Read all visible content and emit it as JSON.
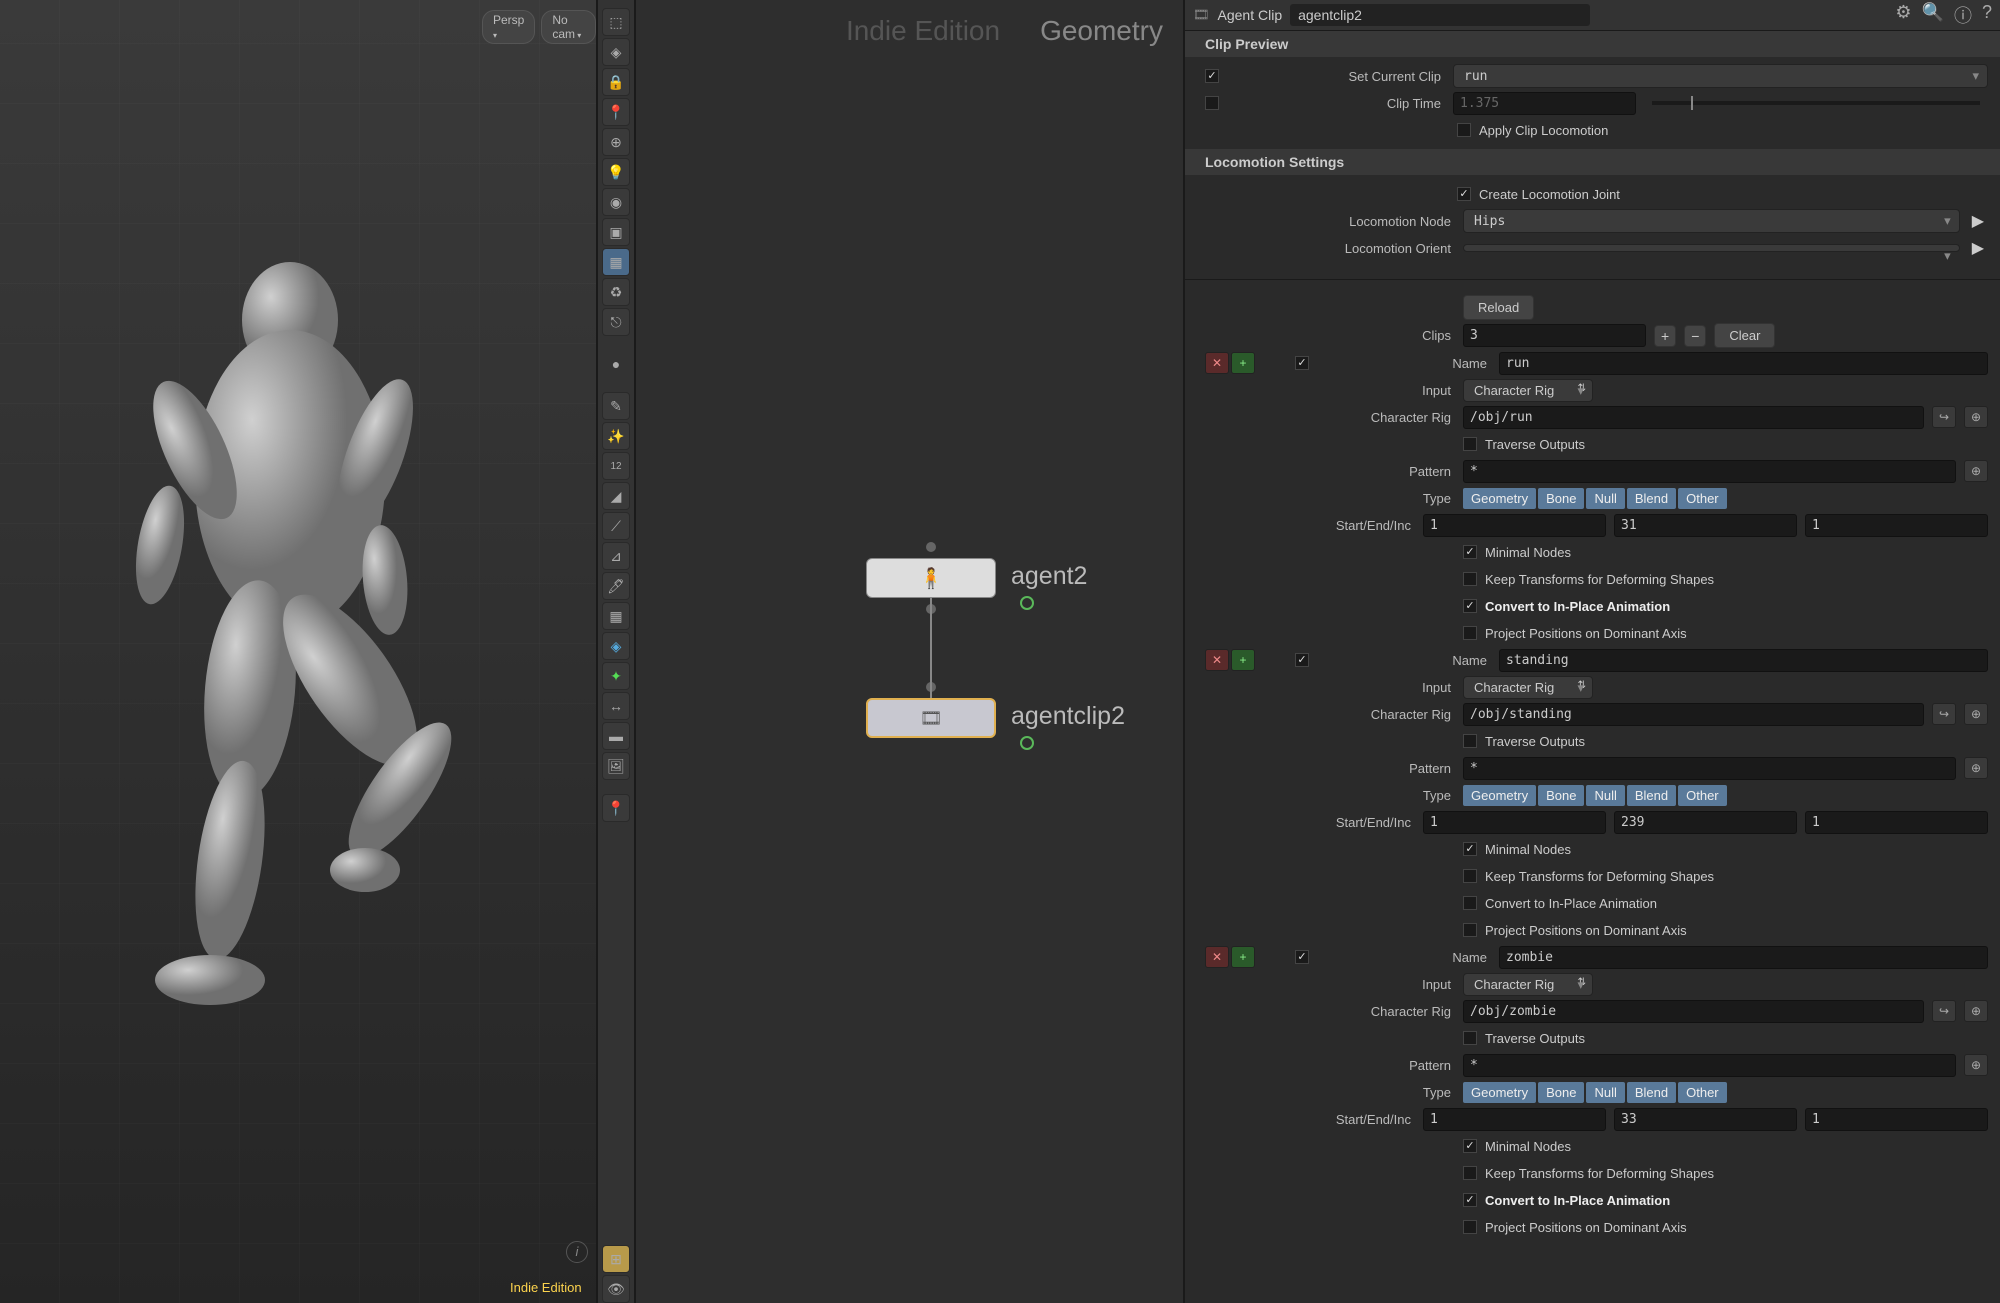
{
  "viewport": {
    "persp_btn": "Persp",
    "cam_btn": "No cam",
    "edition": "Indie Edition"
  },
  "network": {
    "title1": "Indie Edition",
    "title2": "Geometry",
    "nodes": {
      "agent2": "agent2",
      "agentclip2": "agentclip2"
    }
  },
  "params": {
    "node_type": "Agent Clip",
    "node_name": "agentclip2",
    "clip_preview": {
      "header": "Clip Preview",
      "set_clip_label": "Set Current Clip",
      "set_clip_value": "run",
      "clip_time_label": "Clip Time",
      "clip_time_value": "1.375",
      "apply_loco": "Apply Clip Locomotion"
    },
    "loco": {
      "header": "Locomotion Settings",
      "create_joint": "Create Locomotion Joint",
      "node_label": "Locomotion Node",
      "node_value": "Hips",
      "orient_label": "Locomotion Orient",
      "orient_value": ""
    },
    "reload": "Reload",
    "clips_label": "Clips",
    "clips_count": "3",
    "clear": "Clear",
    "clip_labels": {
      "name": "Name",
      "input": "Input",
      "char_rig": "Character Rig",
      "traverse": "Traverse Outputs",
      "pattern": "Pattern",
      "type": "Type",
      "sei": "Start/End/Inc",
      "minimal": "Minimal Nodes",
      "keep_xform": "Keep Transforms for Deforming Shapes",
      "inplace": "Convert to In-Place Animation",
      "project": "Project Positions on Dominant Axis",
      "input_val": "Character Rig"
    },
    "types": [
      "Geometry",
      "Bone",
      "Null",
      "Blend",
      "Other"
    ],
    "clips": [
      {
        "name": "run",
        "rig": "/obj/run",
        "pattern": "*",
        "start": "1",
        "end": "31",
        "inc": "1",
        "minimal": true,
        "keep": false,
        "inplace": true,
        "project": false
      },
      {
        "name": "standing",
        "rig": "/obj/standing",
        "pattern": "*",
        "start": "1",
        "end": "239",
        "inc": "1",
        "minimal": true,
        "keep": false,
        "inplace": false,
        "project": false
      },
      {
        "name": "zombie",
        "rig": "/obj/zombie",
        "pattern": "*",
        "start": "1",
        "end": "33",
        "inc": "1",
        "minimal": true,
        "keep": false,
        "inplace": true,
        "project": false
      }
    ]
  }
}
